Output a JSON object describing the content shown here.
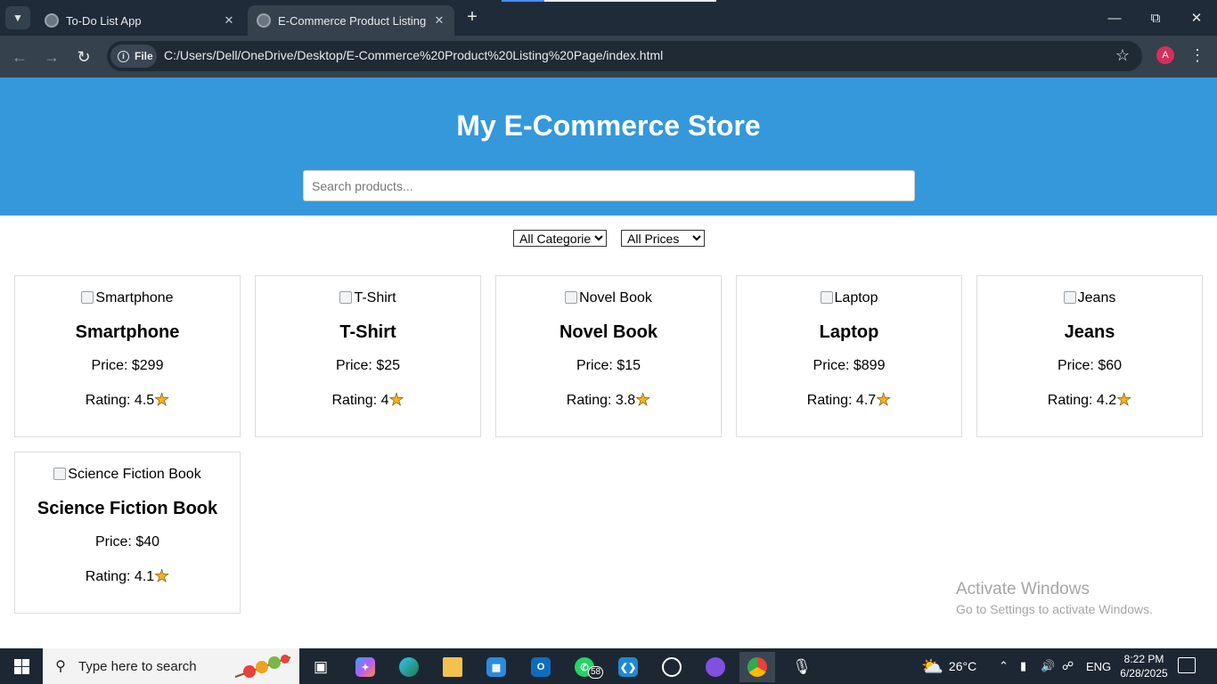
{
  "browser": {
    "tabs": [
      {
        "title": "To-Do List App",
        "active": false
      },
      {
        "title": "E-Commerce Product Listing",
        "active": true
      }
    ],
    "chip_label": "File",
    "url": "C:/Users/Dell/OneDrive/Desktop/E-Commerce%20Product%20Listing%20Page/index.html",
    "profile_initial": "A"
  },
  "store": {
    "title": "My E-Commerce Store",
    "search_placeholder": "Search products...",
    "category_filter": {
      "selected": "All Categories"
    },
    "price_filter": {
      "selected": "All Prices"
    },
    "price_prefix": "Price: ",
    "rating_prefix": "Rating: ",
    "products": [
      {
        "name": "Smartphone",
        "price": "$299",
        "rating": "4.5"
      },
      {
        "name": "T-Shirt",
        "price": "$25",
        "rating": "4"
      },
      {
        "name": "Novel Book",
        "price": "$15",
        "rating": "3.8"
      },
      {
        "name": "Laptop",
        "price": "$899",
        "rating": "4.7"
      },
      {
        "name": "Jeans",
        "price": "$60",
        "rating": "4.2"
      },
      {
        "name": "Science Fiction Book",
        "price": "$40",
        "rating": "4.1"
      }
    ]
  },
  "watermark": {
    "line1": "Activate Windows",
    "line2": "Go to Settings to activate Windows."
  },
  "taskbar": {
    "search_label": "Type here to search",
    "whatsapp_badge": "58",
    "weather": "26°C",
    "weather_badge": "1",
    "language": "ENG",
    "time": "8:22 PM",
    "date": "6/28/2025"
  }
}
